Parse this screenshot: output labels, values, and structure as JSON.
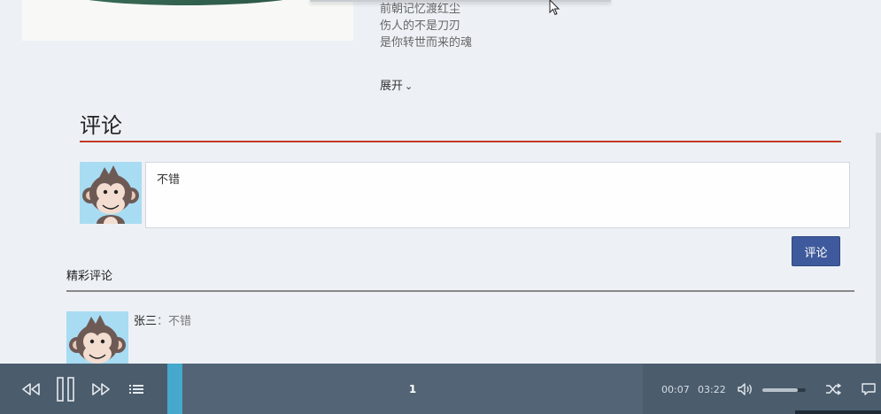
{
  "lyrics": {
    "lines": [
      "前朝记忆渡红尘",
      "伤人的不是刀刃",
      "是你转世而来的魂"
    ],
    "expand_label": "展开"
  },
  "comments": {
    "section_title": "评论",
    "input_value": "不错",
    "submit_label": "评论",
    "hot_title": "精彩评论",
    "items": [
      {
        "user": "张三",
        "separator": "：",
        "text": "不错"
      }
    ]
  },
  "player": {
    "track_number": "1",
    "current_time": "00:07",
    "total_time": "03:22",
    "volume": 0.82,
    "accent_color": "#45a8cd",
    "icons": [
      "prev-icon",
      "pause-icon",
      "next-icon",
      "playlist-icon",
      "volume-icon",
      "shuffle-icon",
      "lyrics-icon"
    ]
  },
  "colors": {
    "title_rule": "#c23b22",
    "submit_button": "#3f5a9c",
    "player_bg": "#4b5c6c"
  }
}
